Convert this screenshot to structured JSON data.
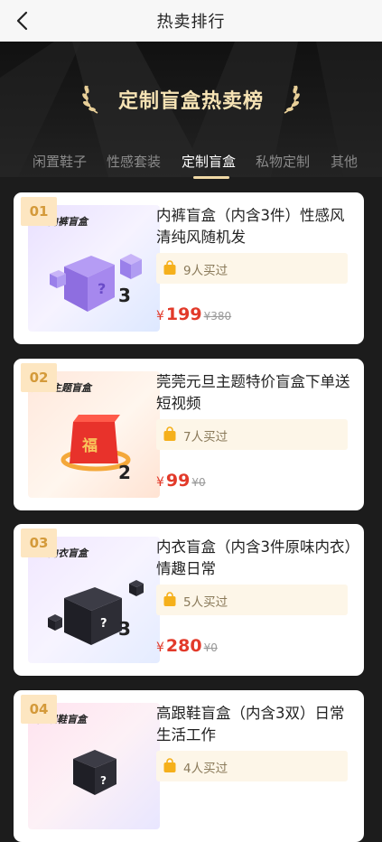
{
  "nav": {
    "title": "热卖排行"
  },
  "banner": {
    "headline": "定制盲盒热卖榜"
  },
  "tabs": [
    {
      "label": "闲置鞋子"
    },
    {
      "label": "性感套装"
    },
    {
      "label": "定制盲盒"
    },
    {
      "label": "私物定制"
    },
    {
      "label": "其他"
    }
  ],
  "products": [
    {
      "rank": "01",
      "title": "内裤盲盒（内含3件）性感风清纯风随机发",
      "buyers": "9人买过",
      "currency": "¥",
      "price": "199",
      "original_price": "¥380",
      "thumb_label": "内裤盲盒",
      "thumb_count": "3"
    },
    {
      "rank": "02",
      "title": "莞莞元旦主题特价盲盒下单送短视频",
      "buyers": "7人买过",
      "currency": "¥",
      "price": "99",
      "original_price": "¥0",
      "thumb_label": "元旦主题盲盒",
      "thumb_count": "2",
      "thumb_mark": "福"
    },
    {
      "rank": "03",
      "title": "内衣盲盒（内含3件原味内衣）情趣日常",
      "buyers": "5人买过",
      "currency": "¥",
      "price": "280",
      "original_price": "¥0",
      "thumb_label": "内衣盲盒",
      "thumb_count": "3"
    },
    {
      "rank": "04",
      "title": "高跟鞋盲盒（内含3双）日常生活工作",
      "buyers": "4人买过",
      "currency": "¥",
      "price": "",
      "original_price": "",
      "thumb_label": "高跟鞋盲盒",
      "thumb_count": ""
    }
  ],
  "colors": {
    "accent_gold": "#f0d9a6",
    "price_red": "#e23a2a",
    "rank_bg": "#fde6c1",
    "buy_bg": "#fdf6e8"
  }
}
